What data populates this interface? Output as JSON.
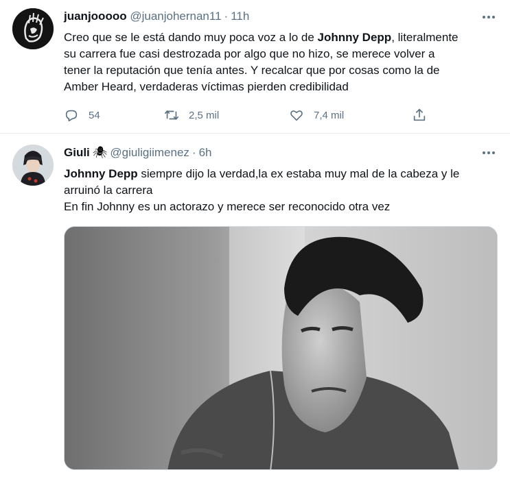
{
  "tweets": [
    {
      "display_name": "juanjooooo",
      "handle": "@juanjohernan11",
      "time": "11h",
      "lines": [
        {
          "pre": "Creo que se le está dando muy poca voz a lo de ",
          "bold": "Johnny Depp",
          "post": ", literalmente"
        },
        {
          "pre": "su carrera fue casi destrozada por algo que no hizo, se merece volver a",
          "bold": "",
          "post": ""
        },
        {
          "pre": "tener la reputación que tenía antes. Y recalcar que por cosas como la de",
          "bold": "",
          "post": ""
        },
        {
          "pre": "Amber Heard, verdaderas víctimas pierden credibilidad",
          "bold": "",
          "post": ""
        }
      ],
      "stats": {
        "replies": "54",
        "retweets": "2,5 mil",
        "likes": "7,4 mil"
      }
    },
    {
      "display_name": "Giuli",
      "name_emoji": "🕷",
      "handle": "@giuligiimenez",
      "time": "6h",
      "lines": [
        {
          "pre": "",
          "bold": "Johnny Depp",
          "post": " siempre dijo la verdad,la ex estaba muy mal de la cabeza y le"
        },
        {
          "pre": "arruinó la carrera",
          "bold": "",
          "post": ""
        },
        {
          "pre": "En fin Johnny es un actorazo y merece ser reconocido otra vez",
          "bold": "",
          "post": ""
        }
      ]
    }
  ],
  "separator": "·",
  "colors": {
    "secondary_text": "#5b7083",
    "primary_text": "#0f1419",
    "divider": "#e6ecf0"
  },
  "icons": {
    "reply": "comment-bubble-icon",
    "retweet": "retweet-arrows-icon",
    "like": "heart-icon",
    "share": "share-upload-icon",
    "more": "more-dots-icon"
  }
}
